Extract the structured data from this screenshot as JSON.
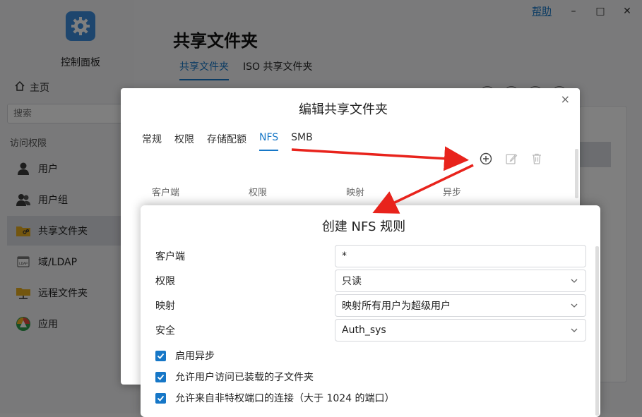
{
  "window": {
    "help_label": "帮助",
    "minimize": "–",
    "maximize": "□",
    "close": "✕"
  },
  "sidebar": {
    "app_title": "控制面板",
    "home_label": "主页",
    "search_placeholder": "搜索",
    "section_label": "访问权限",
    "items": [
      {
        "label": "用户",
        "icon": "user-icon"
      },
      {
        "label": "用户组",
        "icon": "group-icon"
      },
      {
        "label": "共享文件夹",
        "icon": "shared-folder-icon",
        "active": true
      },
      {
        "label": "域/LDAP",
        "icon": "ldap-icon"
      },
      {
        "label": "远程文件夹",
        "icon": "remote-folder-icon"
      },
      {
        "label": "应用",
        "icon": "app-icon"
      }
    ]
  },
  "main": {
    "title": "共享文件夹",
    "tabs": [
      {
        "label": "共享文件夹",
        "active": true
      },
      {
        "label": "ISO 共享文件夹",
        "active": false
      }
    ]
  },
  "edit_dialog": {
    "title": "编辑共享文件夹",
    "close": "×",
    "tabs": [
      {
        "label": "常规",
        "active": false
      },
      {
        "label": "权限",
        "active": false
      },
      {
        "label": "存储配额",
        "active": false
      },
      {
        "label": "NFS",
        "active": true
      },
      {
        "label": "SMB",
        "active": false
      }
    ],
    "columns": [
      "客户端",
      "权限",
      "映射",
      "异步"
    ]
  },
  "nfs_dialog": {
    "title": "创建 NFS 规则",
    "fields": {
      "client_label": "客户端",
      "client_value": "*",
      "permission_label": "权限",
      "permission_value": "只读",
      "mapping_label": "映射",
      "mapping_value": "映射所有用户为超级用户",
      "security_label": "安全",
      "security_value": "Auth_sys"
    },
    "checkboxes": [
      {
        "label": "启用异步",
        "checked": true
      },
      {
        "label": "允许用户访问已装载的子文件夹",
        "checked": true
      },
      {
        "label": "允许来自非特权端口的连接（大于 1024 的端口）",
        "checked": true
      }
    ]
  },
  "colors": {
    "accent": "#1677c7",
    "arrow": "#e8231c"
  }
}
